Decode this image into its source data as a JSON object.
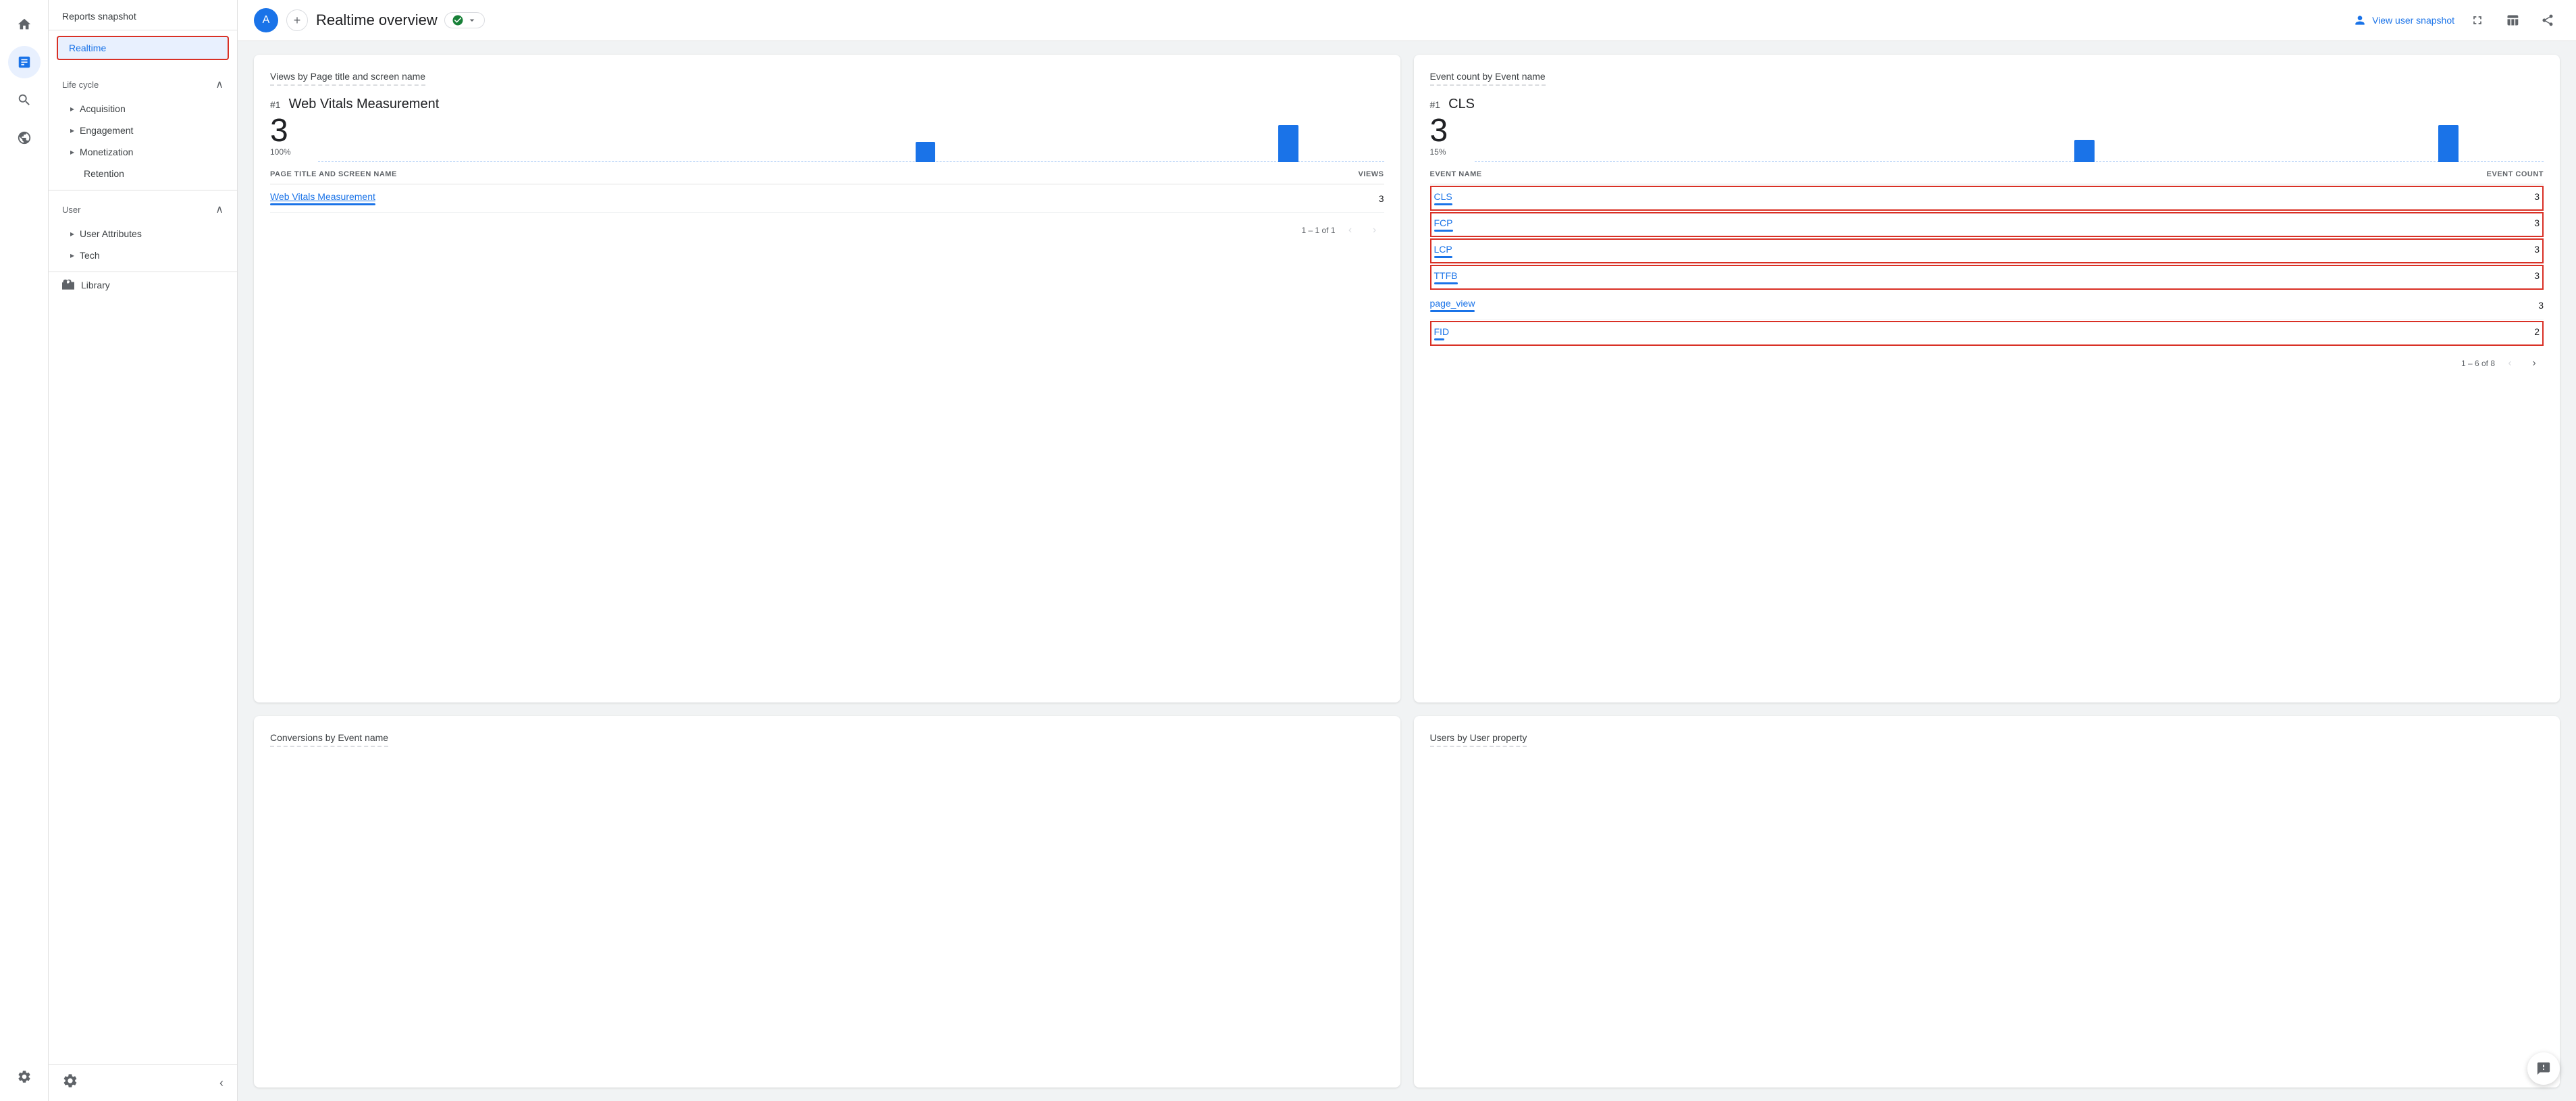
{
  "iconSidebar": {
    "icons": [
      {
        "name": "home-icon",
        "symbol": "⌂",
        "active": false
      },
      {
        "name": "chart-icon",
        "symbol": "▦",
        "active": true
      },
      {
        "name": "search-icon",
        "symbol": "◎",
        "active": false
      },
      {
        "name": "signal-icon",
        "symbol": "◉",
        "active": false
      }
    ],
    "bottomIcons": [
      {
        "name": "settings-icon",
        "symbol": "⚙"
      }
    ]
  },
  "leftNav": {
    "header": "Reports snapshot",
    "selectedItem": "Realtime",
    "sections": [
      {
        "title": "Life cycle",
        "expanded": true,
        "items": [
          "Acquisition",
          "Engagement",
          "Monetization",
          "Retention"
        ]
      },
      {
        "title": "User",
        "expanded": true,
        "items": [
          "User Attributes",
          "Tech"
        ]
      }
    ],
    "library": "Library",
    "settingsLabel": "⚙",
    "collapseLabel": "‹"
  },
  "header": {
    "avatarLabel": "A",
    "addLabel": "+",
    "reportTitle": "Realtime overview",
    "statusLabel": "✓",
    "statusText": "▾",
    "viewSnapshotLabel": "View user snapshot",
    "expandLabel": "⛶",
    "tableLabel": "▦",
    "shareLabel": "⎘"
  },
  "cards": {
    "card1": {
      "title": "Views by Page title and screen name",
      "rank": "#1",
      "pageName": "Web Vitals Measurement",
      "bigNumber": "3",
      "subLabel": "100%",
      "tableHeader": {
        "col1": "PAGE TITLE AND SCREEN NAME",
        "col2": "VIEWS"
      },
      "rows": [
        {
          "name": "Web Vitals Measurement",
          "value": "3",
          "barWidth": 100,
          "highlighted": false
        }
      ],
      "pagination": "1 – 1 of 1",
      "chartBars": [
        0,
        0,
        0,
        0,
        0,
        0,
        0,
        0,
        0,
        0,
        0,
        0,
        0,
        0,
        0,
        0,
        0,
        0,
        0,
        0,
        0,
        0,
        0,
        0,
        0,
        0,
        0,
        0,
        55,
        0,
        0,
        0,
        0,
        0,
        0,
        0,
        0,
        0,
        0,
        0,
        0,
        0,
        0,
        0,
        0,
        100,
        0,
        0,
        0,
        0
      ]
    },
    "card2": {
      "title": "Event count by Event name",
      "rank": "#1",
      "pageName": "CLS",
      "bigNumber": "3",
      "subLabel": "15%",
      "tableHeader": {
        "col1": "EVENT NAME",
        "col2": "EVENT COUNT"
      },
      "rows": [
        {
          "name": "CLS",
          "value": "3",
          "barWidth": 100,
          "highlighted": true
        },
        {
          "name": "FCP",
          "value": "3",
          "barWidth": 100,
          "highlighted": true
        },
        {
          "name": "LCP",
          "value": "3",
          "barWidth": 100,
          "highlighted": true
        },
        {
          "name": "TTFB",
          "value": "3",
          "barWidth": 100,
          "highlighted": true
        },
        {
          "name": "page_view",
          "value": "3",
          "barWidth": 100,
          "highlighted": false
        },
        {
          "name": "FID",
          "value": "2",
          "barWidth": 67,
          "highlighted": true
        }
      ],
      "pagination": "1 – 6 of 8",
      "chartBars": [
        0,
        0,
        0,
        0,
        0,
        0,
        0,
        0,
        0,
        0,
        0,
        0,
        0,
        0,
        0,
        0,
        0,
        0,
        0,
        0,
        0,
        0,
        0,
        0,
        0,
        0,
        0,
        0,
        60,
        0,
        0,
        0,
        0,
        0,
        0,
        0,
        0,
        0,
        0,
        0,
        0,
        0,
        0,
        0,
        0,
        100,
        0,
        0,
        0,
        0
      ]
    },
    "card3": {
      "title": "Conversions by Event name"
    },
    "card4": {
      "title": "Users by User property"
    }
  }
}
